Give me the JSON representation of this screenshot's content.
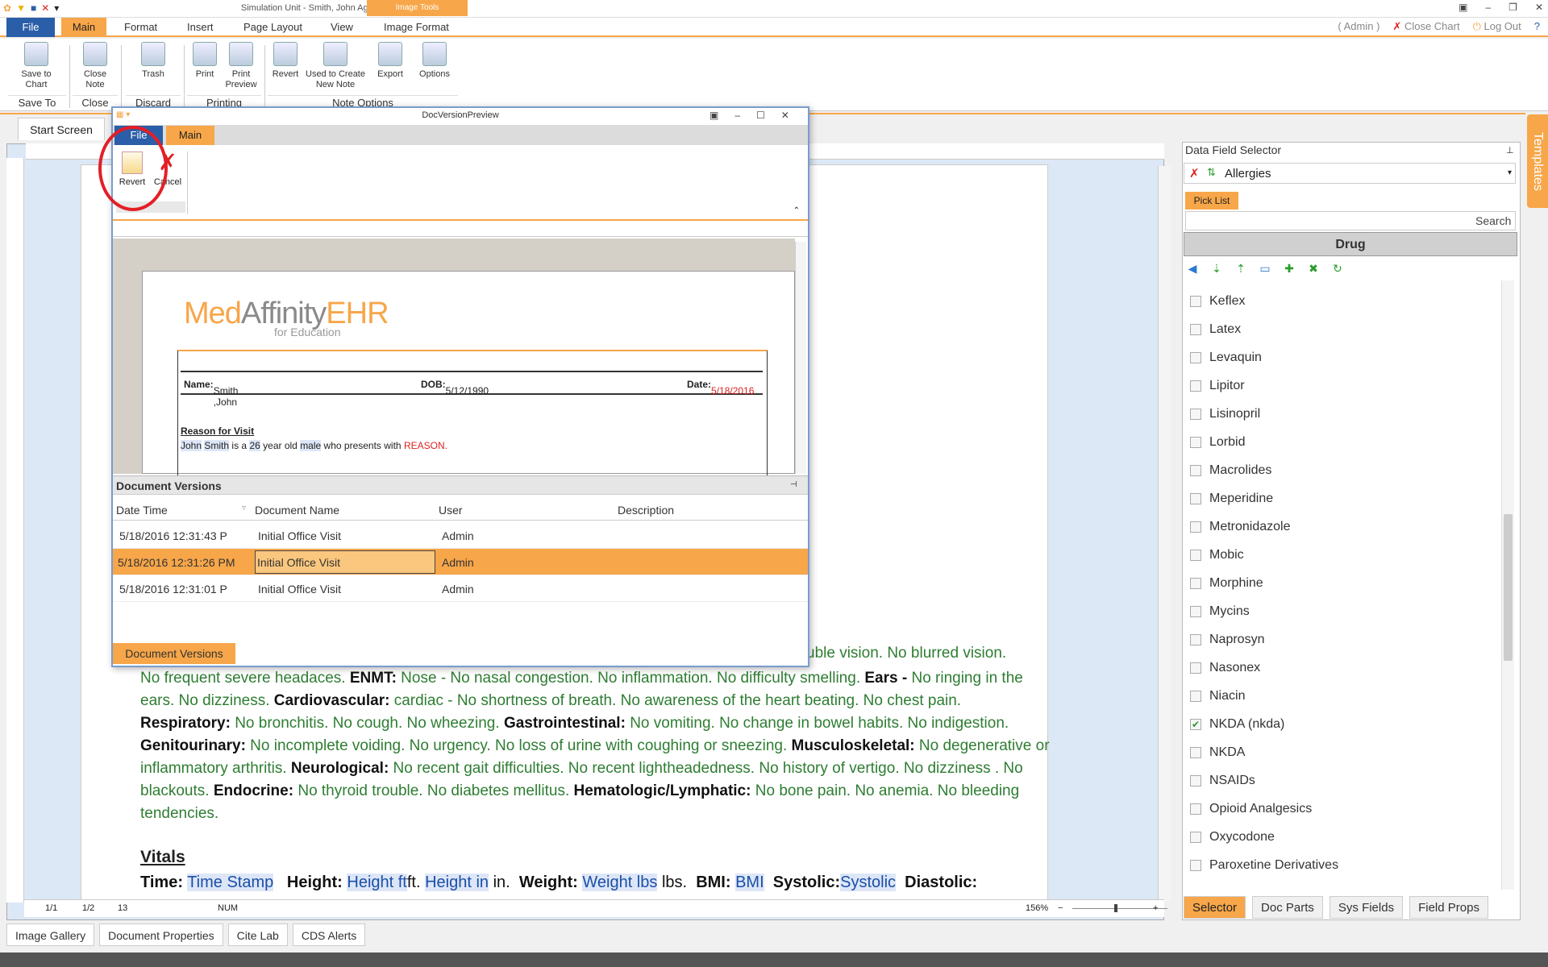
{
  "window": {
    "title": "Simulation Unit - Smith, John Age: 26",
    "image_tools": "Image Tools"
  },
  "tabs": {
    "file": "File",
    "main": "Main",
    "format": "Format",
    "insert": "Insert",
    "page_layout": "Page Layout",
    "view": "View",
    "image_format": "Image Format"
  },
  "topright": {
    "admin": "( Admin )",
    "close_chart": "Close Chart",
    "logout": "Log Out"
  },
  "ribbon": {
    "save_to_chart": "Save to Chart",
    "close_note": "Close Note",
    "trash": "Trash",
    "print": "Print",
    "print_preview": "Print Preview",
    "revert": "Revert",
    "used_to_create": "Used to Create New Note",
    "export": "Export",
    "options": "Options",
    "groups": {
      "save_to": "Save To",
      "close": "Close",
      "discard": "Discard",
      "printing": "Printing",
      "note_options": "Note Options"
    }
  },
  "start_screen": "Start Screen",
  "document": {
    "line1": "uble vision. No blurred vision.",
    "ros": [
      {
        "t": "No frequent severe headaces. "
      },
      {
        "b": "ENMT:"
      },
      {
        "t": " Nose -  No nasal congestion. No inflammation. No difficulty smelling. "
      },
      {
        "b": "Ears -"
      },
      {
        "t": "  No ringing in the ears. No dizziness. "
      },
      {
        "b": "Cardiovascular:"
      },
      {
        "t": " cardiac -  No shortness of breath. No awareness of the heart beating. No chest pain. "
      },
      {
        "b": "Respiratory:"
      },
      {
        "t": "  No bronchitis. No  cough. No wheezing. "
      },
      {
        "b": "Gastrointestinal:"
      },
      {
        "t": "  No vomiting. No change in bowel habits. No indigestion. "
      },
      {
        "b": "Genitourinary:"
      },
      {
        "t": "  No incomplete voiding. No urgency. No loss of urine with coughing or sneezing. "
      },
      {
        "b": "Musculoskeletal:"
      },
      {
        "t": "  No degenerative or inflammatory arthritis. "
      },
      {
        "b": "Neurological:"
      },
      {
        "t": "  No recent gait difficulties. No recent lightheadedness. No history of vertigo. No dizziness . No blackouts. "
      },
      {
        "b": "Endocrine:"
      },
      {
        "t": "  No thyroid trouble. No diabetes mellitus. "
      },
      {
        "b": "Hematologic/Lymphatic:"
      },
      {
        "t": "  No bone pain. No anemia. No bleeding tendencies."
      }
    ],
    "vitals_heading": "Vitals",
    "vitals": {
      "time_label": "Time:",
      "time_field": "Time Stamp",
      "height_label": "Height:",
      "height_ft": "Height ft",
      "ft": "ft.",
      "height_in": "Height in",
      "in": "in.",
      "weight_label": "Weight:",
      "weight_field": "Weight lbs",
      "lbs": "lbs.",
      "bmi_label": "BMI:",
      "bmi_field": "BMI",
      "systolic_label": "Systolic:",
      "systolic_field": "Systolic",
      "diastolic_label": "Diastolic:"
    }
  },
  "status": {
    "p1": "1/1",
    "p2": "1/2",
    "p3": "13",
    "num": "NUM",
    "zoom": "156%"
  },
  "bottom_tabs": [
    "Image Gallery",
    "Document Properties",
    "Cite Lab",
    "CDS Alerts"
  ],
  "right_panel": {
    "title": "Data Field Selector",
    "combo_value": "Allergies",
    "pick_list": "Pick List",
    "search": "Search",
    "header": "Drug",
    "drugs": [
      {
        "name": "Keflex",
        "checked": false
      },
      {
        "name": "Latex",
        "checked": false
      },
      {
        "name": "Levaquin",
        "checked": false
      },
      {
        "name": "Lipitor",
        "checked": false
      },
      {
        "name": "Lisinopril",
        "checked": false
      },
      {
        "name": "Lorbid",
        "checked": false
      },
      {
        "name": "Macrolides",
        "checked": false
      },
      {
        "name": "Meperidine",
        "checked": false
      },
      {
        "name": "Metronidazole",
        "checked": false
      },
      {
        "name": "Mobic",
        "checked": false
      },
      {
        "name": "Morphine",
        "checked": false
      },
      {
        "name": "Mycins",
        "checked": false
      },
      {
        "name": "Naprosyn",
        "checked": false
      },
      {
        "name": "Nasonex",
        "checked": false
      },
      {
        "name": "Niacin",
        "checked": false
      },
      {
        "name": "NKDA (nkda)",
        "checked": true
      },
      {
        "name": "NKDA",
        "checked": false
      },
      {
        "name": "NSAIDs",
        "checked": false
      },
      {
        "name": "Opioid Analgesics",
        "checked": false
      },
      {
        "name": "Oxycodone",
        "checked": false
      },
      {
        "name": "Paroxetine Derivatives",
        "checked": false
      }
    ],
    "tabs": [
      "Selector",
      "Doc Parts",
      "Sys Fields",
      "Field Props"
    ]
  },
  "templates": "Templates",
  "dialog": {
    "title": "DocVersionPreview",
    "file": "File",
    "main": "Main",
    "revert": "Revert",
    "cancel": "Cancel",
    "logo_med": "Med",
    "logo_affinity": "Affinity",
    "logo_ehr": "EHR",
    "logo_sub": "for Education",
    "name_label": "Name:",
    "name_value": "Smith ,John",
    "dob_label": "DOB:",
    "dob_value": "5/12/1990",
    "date_label": "Date:",
    "date_value": "5/18/2016",
    "reason_heading": "Reason for Visit",
    "reason_john": "John",
    "reason_smith": "Smith",
    "reason_is_a": "is a",
    "reason_age": "26",
    "reason_year_old": "year old",
    "reason_sex": "male",
    "reason_who": "who presents with",
    "reason_value": "REASON.",
    "versions_title": "Document Versions",
    "columns": [
      "Date Time",
      "Document Name",
      "User",
      "Description"
    ],
    "rows": [
      {
        "dt": "5/18/2016 12:31:43 P",
        "name": "Initial Office Visit",
        "user": "Admin"
      },
      {
        "dt": "5/18/2016 12:31:26 PM",
        "name": "Initial Office Visit",
        "user": "Admin"
      },
      {
        "dt": "5/18/2016 12:31:01 P",
        "name": "Initial Office Visit",
        "user": "Admin"
      }
    ],
    "versions_tab": "Document Versions"
  }
}
